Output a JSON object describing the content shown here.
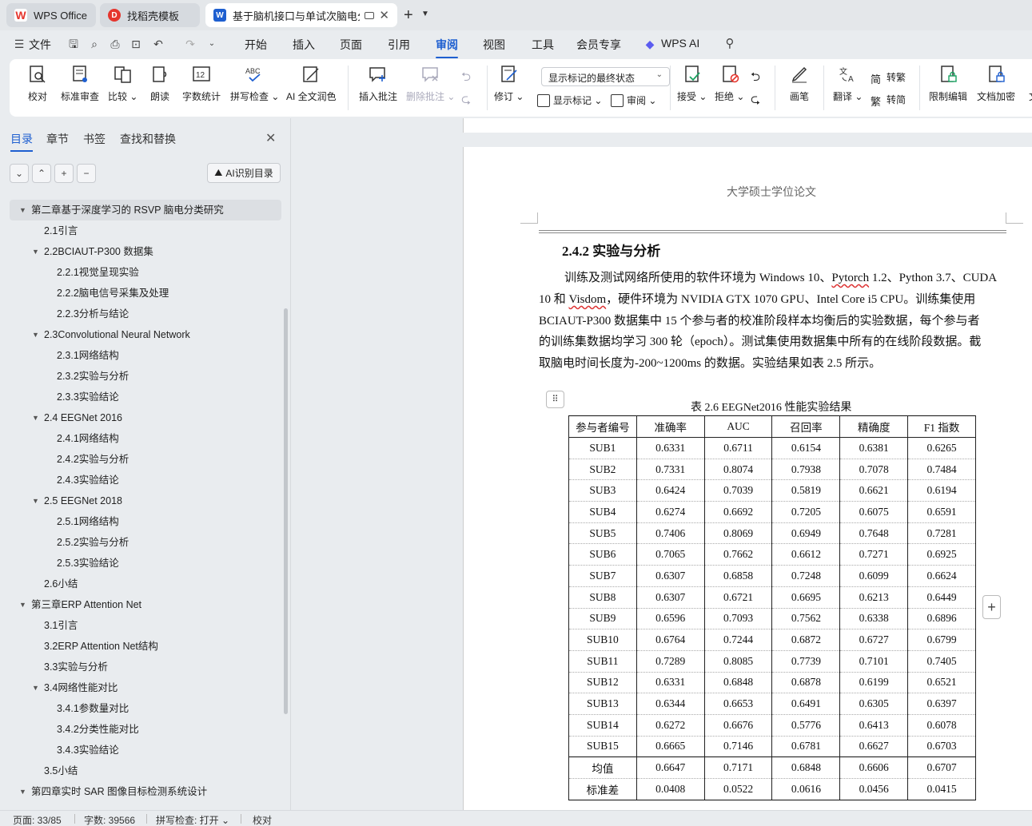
{
  "tabs": [
    {
      "label": "WPS Office",
      "icon": "wps-logo-icon"
    },
    {
      "label": "找稻壳模板",
      "icon": "docer-icon"
    },
    {
      "label": "基于脑机接口与单试次脑电分",
      "icon": "word-doc-icon"
    }
  ],
  "menu": {
    "file": "文件",
    "items": [
      "开始",
      "插入",
      "页面",
      "引用",
      "审阅",
      "视图",
      "工具",
      "会员专享",
      "WPS AI"
    ],
    "active": "审阅"
  },
  "ribbon": {
    "proofread": "校对",
    "standard_review": "标准审查",
    "compare": "比较",
    "read_aloud": "朗读",
    "word_count": "字数统计",
    "spell_check": "拼写检查",
    "ai_polish": "AI 全文润色",
    "insert_comment": "插入批注",
    "delete_comment": "删除批注",
    "track_changes": "修订",
    "markup_select": "显示标记的最终状态",
    "show_markup": "显示标记",
    "review_pane": "审阅",
    "accept": "接受",
    "reject": "拒绝",
    "ink": "画笔",
    "translate": "翻译",
    "to_traditional": "转繁",
    "to_simplified": "转简",
    "restrict_editing": "限制编辑",
    "doc_encrypt": "文档加密",
    "doc_cut": "文"
  },
  "panel": {
    "tabs": [
      "目录",
      "章节",
      "书签",
      "查找和替换"
    ],
    "ai_button": "AI识别目录",
    "toc": [
      {
        "label": "第二章基于深度学习的 RSVP 脑电分类研究",
        "level": 1,
        "expanded": true,
        "selected": true
      },
      {
        "label": "2.1引言",
        "level": 2
      },
      {
        "label": "2.2BCIAUT-P300 数据集",
        "level": 2,
        "expanded": true
      },
      {
        "label": "2.2.1视觉呈现实验",
        "level": 3
      },
      {
        "label": "2.2.2脑电信号采集及处理",
        "level": 3
      },
      {
        "label": "2.2.3分析与结论",
        "level": 3
      },
      {
        "label": "2.3Convolutional Neural Network",
        "level": 2,
        "expanded": true
      },
      {
        "label": "2.3.1网络结构",
        "level": 3
      },
      {
        "label": "2.3.2实验与分析",
        "level": 3
      },
      {
        "label": "2.3.3实验结论",
        "level": 3
      },
      {
        "label": "2.4  EEGNet 2016",
        "level": 2,
        "expanded": true
      },
      {
        "label": "2.4.1网络结构",
        "level": 3
      },
      {
        "label": "2.4.2实验与分析",
        "level": 3
      },
      {
        "label": "2.4.3实验结论",
        "level": 3
      },
      {
        "label": "2.5  EEGNet 2018",
        "level": 2,
        "expanded": true
      },
      {
        "label": "2.5.1网络结构",
        "level": 3
      },
      {
        "label": "2.5.2实验与分析",
        "level": 3
      },
      {
        "label": "2.5.3实验结论",
        "level": 3
      },
      {
        "label": "2.6小结",
        "level": 2
      },
      {
        "label": "第三章ERP Attention Net",
        "level": 1,
        "expanded": true
      },
      {
        "label": "3.1引言",
        "level": 2
      },
      {
        "label": "3.2ERP Attention Net结构",
        "level": 2
      },
      {
        "label": "3.3实验与分析",
        "level": 2
      },
      {
        "label": "3.4网络性能对比",
        "level": 2,
        "expanded": true
      },
      {
        "label": "3.4.1参数量对比",
        "level": 3
      },
      {
        "label": "3.4.2分类性能对比",
        "level": 3
      },
      {
        "label": "3.4.3实验结论",
        "level": 3
      },
      {
        "label": "3.5小结",
        "level": 2
      },
      {
        "label": "第四章实时 SAR 图像目标检测系统设计",
        "level": 1,
        "expanded": true
      }
    ]
  },
  "document": {
    "header": "大学硕士学位论文",
    "section_title": "2.4.2    实验与分析",
    "paragraph_lines": [
      "训练及测试网络所使用的软件环境为 Windows 10、",
      "Pytorch",
      " 1.2、Python 3.7、CUDA",
      "10 和 ",
      "Visdom",
      "，硬件环境为 NVIDIA GTX 1070 GPU、Intel Core i5 CPU。训练集使用",
      "BCIAUT-P300 数据集中 15 个参与者的校准阶段样本均衡后的实验数据，每个参与者",
      "的训练集数据均学习 300 轮（epoch）。测试集使用数据集中所有的在线阶段数据。截",
      "取脑电时间长度为-200~1200ms 的数据。实验结果如表 2.5 所示。"
    ],
    "table_caption": "表 2.6  EEGNet2016 性能实验结果",
    "table": {
      "headers": [
        "参与者编号",
        "准确率",
        "AUC",
        "召回率",
        "精确度",
        "F1 指数"
      ],
      "rows": [
        [
          "SUB1",
          "0.6331",
          "0.6711",
          "0.6154",
          "0.6381",
          "0.6265"
        ],
        [
          "SUB2",
          "0.7331",
          "0.8074",
          "0.7938",
          "0.7078",
          "0.7484"
        ],
        [
          "SUB3",
          "0.6424",
          "0.7039",
          "0.5819",
          "0.6621",
          "0.6194"
        ],
        [
          "SUB4",
          "0.6274",
          "0.6692",
          "0.7205",
          "0.6075",
          "0.6591"
        ],
        [
          "SUB5",
          "0.7406",
          "0.8069",
          "0.6949",
          "0.7648",
          "0.7281"
        ],
        [
          "SUB6",
          "0.7065",
          "0.7662",
          "0.6612",
          "0.7271",
          "0.6925"
        ],
        [
          "SUB7",
          "0.6307",
          "0.6858",
          "0.7248",
          "0.6099",
          "0.6624"
        ],
        [
          "SUB8",
          "0.6307",
          "0.6721",
          "0.6695",
          "0.6213",
          "0.6449"
        ],
        [
          "SUB9",
          "0.6596",
          "0.7093",
          "0.7562",
          "0.6338",
          "0.6896"
        ],
        [
          "SUB10",
          "0.6764",
          "0.7244",
          "0.6872",
          "0.6727",
          "0.6799"
        ],
        [
          "SUB11",
          "0.7289",
          "0.8085",
          "0.7739",
          "0.7101",
          "0.7405"
        ],
        [
          "SUB12",
          "0.6331",
          "0.6848",
          "0.6878",
          "0.6199",
          "0.6521"
        ],
        [
          "SUB13",
          "0.6344",
          "0.6653",
          "0.6491",
          "0.6305",
          "0.6397"
        ],
        [
          "SUB14",
          "0.6272",
          "0.6676",
          "0.5776",
          "0.6413",
          "0.6078"
        ],
        [
          "SUB15",
          "0.6665",
          "0.7146",
          "0.6781",
          "0.6627",
          "0.6703"
        ]
      ],
      "summary": [
        [
          "均值",
          "0.6647",
          "0.7171",
          "0.6848",
          "0.6606",
          "0.6707"
        ],
        [
          "标准差",
          "0.0408",
          "0.0522",
          "0.0616",
          "0.0456",
          "0.0415"
        ]
      ]
    }
  },
  "status": {
    "page": "页面: 33/85",
    "words": "字数: 39566",
    "spell": "拼写检查: 打开",
    "proof": "校对"
  },
  "colors": {
    "accent": "#1e5fd0",
    "wps_red": "#e5352d"
  }
}
